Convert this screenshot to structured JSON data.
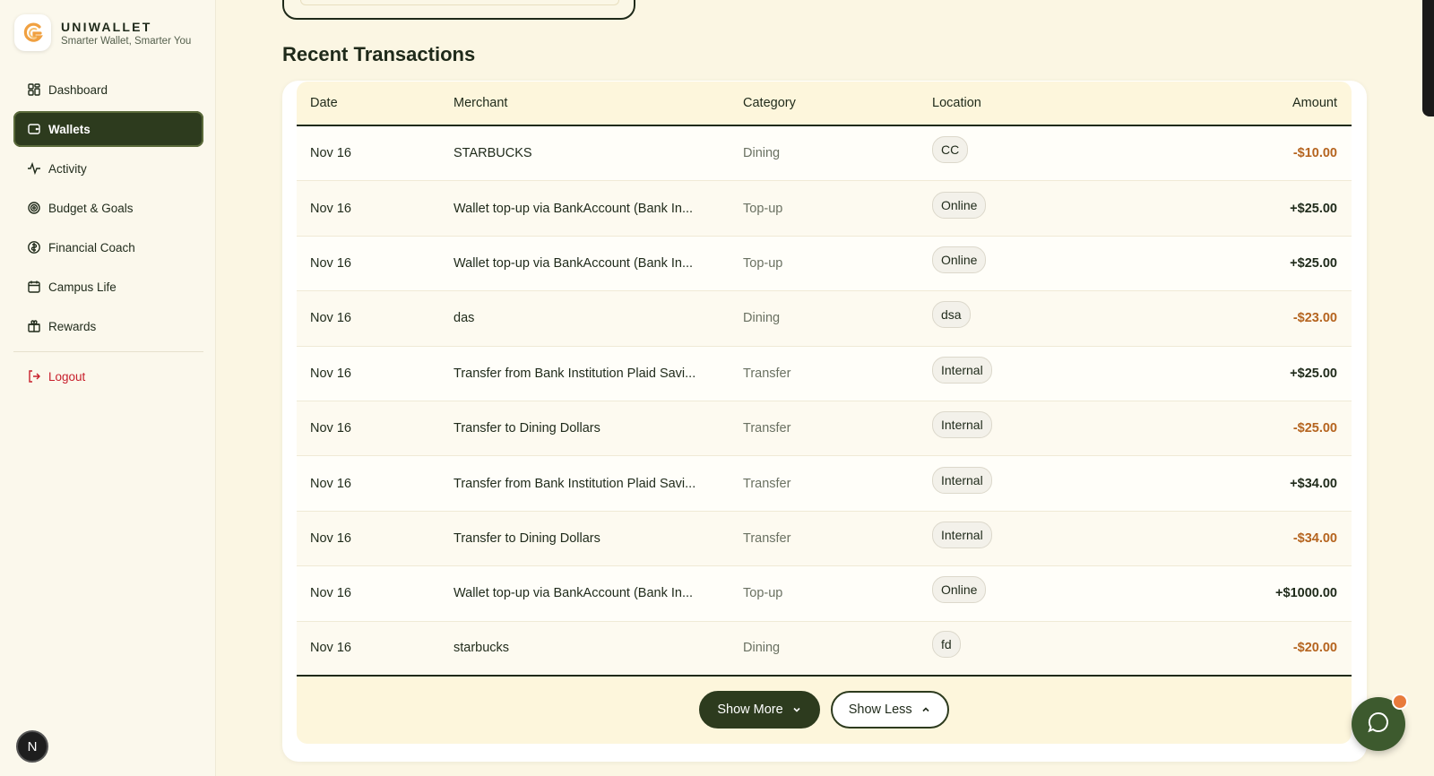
{
  "brand": {
    "name": "UNIWALLET",
    "tagline": "Smarter Wallet, Smarter You",
    "logo_icon": "uniwallet-logo",
    "accent": "#f0a040"
  },
  "sidebar": {
    "items": [
      {
        "label": "Dashboard",
        "icon": "grid-icon"
      },
      {
        "label": "Wallets",
        "icon": "wallet-icon",
        "active": true
      },
      {
        "label": "Activity",
        "icon": "activity-icon"
      },
      {
        "label": "Budget & Goals",
        "icon": "target-icon"
      },
      {
        "label": "Financial Coach",
        "icon": "coach-icon"
      },
      {
        "label": "Campus Life",
        "icon": "calendar-icon"
      },
      {
        "label": "Rewards",
        "icon": "gift-icon"
      }
    ],
    "logout_label": "Logout"
  },
  "section_title": "Recent Transactions",
  "table": {
    "headers": {
      "date": "Date",
      "merchant": "Merchant",
      "category": "Category",
      "location": "Location",
      "amount": "Amount"
    },
    "rows": [
      {
        "date": "Nov 16",
        "merchant": "STARBUCKS",
        "category": "Dining",
        "location": "CC",
        "amount": "-$10.00"
      },
      {
        "date": "Nov 16",
        "merchant": "Wallet top-up via BankAccount (Bank In...",
        "category": "Top-up",
        "location": "Online",
        "amount": "+$25.00"
      },
      {
        "date": "Nov 16",
        "merchant": "Wallet top-up via BankAccount (Bank In...",
        "category": "Top-up",
        "location": "Online",
        "amount": "+$25.00"
      },
      {
        "date": "Nov 16",
        "merchant": "das",
        "category": "Dining",
        "location": "dsa",
        "amount": "-$23.00"
      },
      {
        "date": "Nov 16",
        "merchant": "Transfer from Bank Institution Plaid Savi...",
        "category": "Transfer",
        "location": "Internal",
        "amount": "+$25.00"
      },
      {
        "date": "Nov 16",
        "merchant": "Transfer to Dining Dollars",
        "category": "Transfer",
        "location": "Internal",
        "amount": "-$25.00"
      },
      {
        "date": "Nov 16",
        "merchant": "Transfer from Bank Institution Plaid Savi...",
        "category": "Transfer",
        "location": "Internal",
        "amount": "+$34.00"
      },
      {
        "date": "Nov 16",
        "merchant": "Transfer to Dining Dollars",
        "category": "Transfer",
        "location": "Internal",
        "amount": "-$34.00"
      },
      {
        "date": "Nov 16",
        "merchant": "Wallet top-up via BankAccount (Bank In...",
        "category": "Top-up",
        "location": "Online",
        "amount": "+$1000.00"
      },
      {
        "date": "Nov 16",
        "merchant": "starbucks",
        "category": "Dining",
        "location": "fd",
        "amount": "-$20.00"
      }
    ]
  },
  "buttons": {
    "show_more": "Show More",
    "show_less": "Show Less"
  },
  "next_badge": "N",
  "colors": {
    "primary": "#2d3b1e",
    "negative_amount": "#b5641f",
    "logout": "#c8202c",
    "background": "#fbf6e3"
  }
}
